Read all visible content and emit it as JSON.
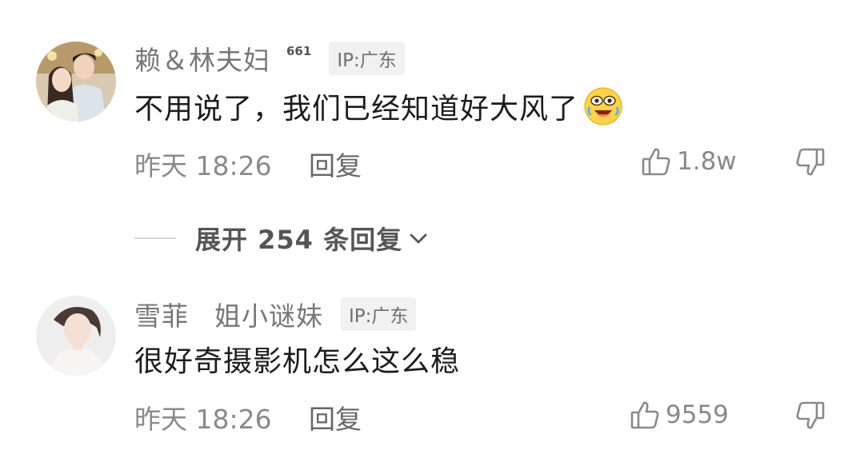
{
  "comments": [
    {
      "username": "赖＆林夫妇",
      "level": "661",
      "ip": "IP:广东",
      "text": "不用说了，我们已经知道好大风了",
      "time": "昨天 18:26",
      "reply_label": "回复",
      "likes": "1.8w"
    },
    {
      "username": "雪菲",
      "sub_name": "姐小谜妹",
      "ip": "IP:广东",
      "text": "很好奇摄影机怎么这么稳",
      "time": "昨天 18:26",
      "reply_label": "回复",
      "likes": "9559"
    }
  ],
  "expand_replies": {
    "label": "展开 254 条回复"
  },
  "icons": {
    "like": "thumbs-up-icon",
    "dislike": "thumbs-down-icon",
    "emoji": "tears-of-joy-emoji-icon",
    "expand": "chevron-down-icon"
  }
}
